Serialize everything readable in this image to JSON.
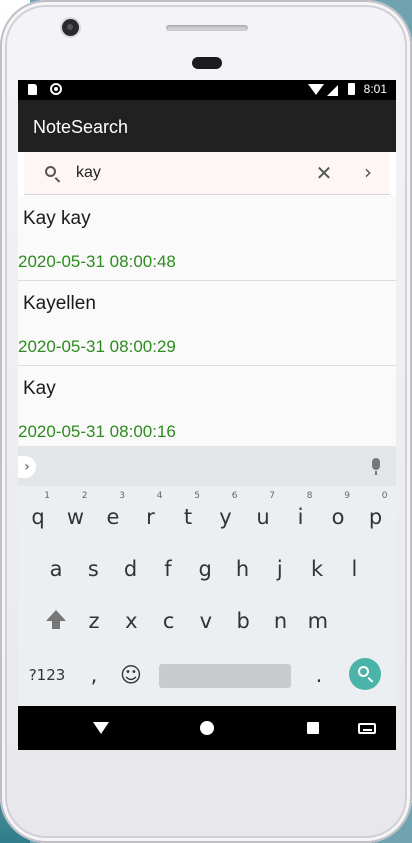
{
  "status_bar": {
    "time": "8:01"
  },
  "app_bar": {
    "title": "NoteSearch"
  },
  "search": {
    "query": "kay",
    "clear_glyph": "✕",
    "submit_glyph": "›"
  },
  "notes": [
    {
      "title": "Kay kay",
      "date": "2020-05-31 08:00:48"
    },
    {
      "title": "Kayellen",
      "date": "2020-05-31 08:00:29"
    },
    {
      "title": "Kay",
      "date": "2020-05-31 08:00:16"
    }
  ],
  "keyboard": {
    "row1": [
      {
        "k": "q",
        "n": "1"
      },
      {
        "k": "w",
        "n": "2"
      },
      {
        "k": "e",
        "n": "3"
      },
      {
        "k": "r",
        "n": "4"
      },
      {
        "k": "t",
        "n": "5"
      },
      {
        "k": "y",
        "n": "6"
      },
      {
        "k": "u",
        "n": "7"
      },
      {
        "k": "i",
        "n": "8"
      },
      {
        "k": "o",
        "n": "9"
      },
      {
        "k": "p",
        "n": "0"
      }
    ],
    "row2": [
      "a",
      "s",
      "d",
      "f",
      "g",
      "h",
      "j",
      "k",
      "l"
    ],
    "row3": [
      "z",
      "x",
      "c",
      "v",
      "b",
      "n",
      "m"
    ],
    "symbols_label": "?123",
    "comma": ",",
    "emoji": "☺",
    "period": ".",
    "expand_glyph": "›"
  },
  "colors": {
    "accent": "#4bb3a7",
    "date": "#2e8b1f",
    "app_bar": "#212121"
  }
}
